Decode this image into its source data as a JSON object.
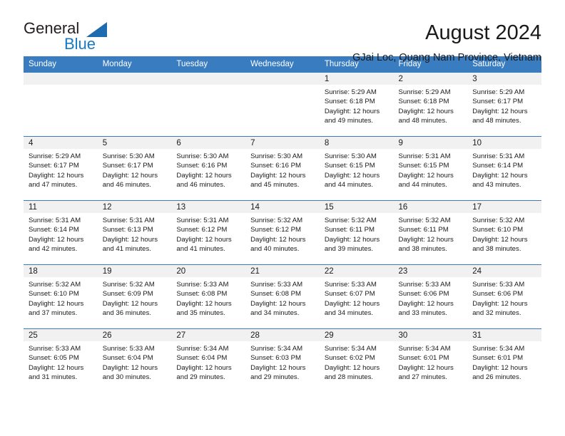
{
  "brand": {
    "name_top": "General",
    "name_bottom": "Blue",
    "triangle_color": "#1f6bb0",
    "blue_text_color": "#1579c4"
  },
  "header": {
    "title": "August 2024",
    "subtitle": "GJai Loc, Quang Nam Province, Vietnam",
    "accent_color": "#3a7cc0",
    "daynum_band_color": "#f1f1f1"
  },
  "weekday_headers": [
    "Sunday",
    "Monday",
    "Tuesday",
    "Wednesday",
    "Thursday",
    "Friday",
    "Saturday"
  ],
  "labels": {
    "sunrise": "Sunrise:",
    "sunset": "Sunset:",
    "daylight": "Daylight:"
  },
  "weeks": [
    [
      {
        "day": "",
        "empty": true
      },
      {
        "day": "",
        "empty": true
      },
      {
        "day": "",
        "empty": true
      },
      {
        "day": "",
        "empty": true
      },
      {
        "day": "1",
        "sunrise": "Sunrise: 5:29 AM",
        "sunset": "Sunset: 6:18 PM",
        "daylight_1": "Daylight: 12 hours",
        "daylight_2": "and 49 minutes."
      },
      {
        "day": "2",
        "sunrise": "Sunrise: 5:29 AM",
        "sunset": "Sunset: 6:18 PM",
        "daylight_1": "Daylight: 12 hours",
        "daylight_2": "and 48 minutes."
      },
      {
        "day": "3",
        "sunrise": "Sunrise: 5:29 AM",
        "sunset": "Sunset: 6:17 PM",
        "daylight_1": "Daylight: 12 hours",
        "daylight_2": "and 48 minutes."
      }
    ],
    [
      {
        "day": "4",
        "sunrise": "Sunrise: 5:29 AM",
        "sunset": "Sunset: 6:17 PM",
        "daylight_1": "Daylight: 12 hours",
        "daylight_2": "and 47 minutes."
      },
      {
        "day": "5",
        "sunrise": "Sunrise: 5:30 AM",
        "sunset": "Sunset: 6:17 PM",
        "daylight_1": "Daylight: 12 hours",
        "daylight_2": "and 46 minutes."
      },
      {
        "day": "6",
        "sunrise": "Sunrise: 5:30 AM",
        "sunset": "Sunset: 6:16 PM",
        "daylight_1": "Daylight: 12 hours",
        "daylight_2": "and 46 minutes."
      },
      {
        "day": "7",
        "sunrise": "Sunrise: 5:30 AM",
        "sunset": "Sunset: 6:16 PM",
        "daylight_1": "Daylight: 12 hours",
        "daylight_2": "and 45 minutes."
      },
      {
        "day": "8",
        "sunrise": "Sunrise: 5:30 AM",
        "sunset": "Sunset: 6:15 PM",
        "daylight_1": "Daylight: 12 hours",
        "daylight_2": "and 44 minutes."
      },
      {
        "day": "9",
        "sunrise": "Sunrise: 5:31 AM",
        "sunset": "Sunset: 6:15 PM",
        "daylight_1": "Daylight: 12 hours",
        "daylight_2": "and 44 minutes."
      },
      {
        "day": "10",
        "sunrise": "Sunrise: 5:31 AM",
        "sunset": "Sunset: 6:14 PM",
        "daylight_1": "Daylight: 12 hours",
        "daylight_2": "and 43 minutes."
      }
    ],
    [
      {
        "day": "11",
        "sunrise": "Sunrise: 5:31 AM",
        "sunset": "Sunset: 6:14 PM",
        "daylight_1": "Daylight: 12 hours",
        "daylight_2": "and 42 minutes."
      },
      {
        "day": "12",
        "sunrise": "Sunrise: 5:31 AM",
        "sunset": "Sunset: 6:13 PM",
        "daylight_1": "Daylight: 12 hours",
        "daylight_2": "and 41 minutes."
      },
      {
        "day": "13",
        "sunrise": "Sunrise: 5:31 AM",
        "sunset": "Sunset: 6:12 PM",
        "daylight_1": "Daylight: 12 hours",
        "daylight_2": "and 41 minutes."
      },
      {
        "day": "14",
        "sunrise": "Sunrise: 5:32 AM",
        "sunset": "Sunset: 6:12 PM",
        "daylight_1": "Daylight: 12 hours",
        "daylight_2": "and 40 minutes."
      },
      {
        "day": "15",
        "sunrise": "Sunrise: 5:32 AM",
        "sunset": "Sunset: 6:11 PM",
        "daylight_1": "Daylight: 12 hours",
        "daylight_2": "and 39 minutes."
      },
      {
        "day": "16",
        "sunrise": "Sunrise: 5:32 AM",
        "sunset": "Sunset: 6:11 PM",
        "daylight_1": "Daylight: 12 hours",
        "daylight_2": "and 38 minutes."
      },
      {
        "day": "17",
        "sunrise": "Sunrise: 5:32 AM",
        "sunset": "Sunset: 6:10 PM",
        "daylight_1": "Daylight: 12 hours",
        "daylight_2": "and 38 minutes."
      }
    ],
    [
      {
        "day": "18",
        "sunrise": "Sunrise: 5:32 AM",
        "sunset": "Sunset: 6:10 PM",
        "daylight_1": "Daylight: 12 hours",
        "daylight_2": "and 37 minutes."
      },
      {
        "day": "19",
        "sunrise": "Sunrise: 5:32 AM",
        "sunset": "Sunset: 6:09 PM",
        "daylight_1": "Daylight: 12 hours",
        "daylight_2": "and 36 minutes."
      },
      {
        "day": "20",
        "sunrise": "Sunrise: 5:33 AM",
        "sunset": "Sunset: 6:08 PM",
        "daylight_1": "Daylight: 12 hours",
        "daylight_2": "and 35 minutes."
      },
      {
        "day": "21",
        "sunrise": "Sunrise: 5:33 AM",
        "sunset": "Sunset: 6:08 PM",
        "daylight_1": "Daylight: 12 hours",
        "daylight_2": "and 34 minutes."
      },
      {
        "day": "22",
        "sunrise": "Sunrise: 5:33 AM",
        "sunset": "Sunset: 6:07 PM",
        "daylight_1": "Daylight: 12 hours",
        "daylight_2": "and 34 minutes."
      },
      {
        "day": "23",
        "sunrise": "Sunrise: 5:33 AM",
        "sunset": "Sunset: 6:06 PM",
        "daylight_1": "Daylight: 12 hours",
        "daylight_2": "and 33 minutes."
      },
      {
        "day": "24",
        "sunrise": "Sunrise: 5:33 AM",
        "sunset": "Sunset: 6:06 PM",
        "daylight_1": "Daylight: 12 hours",
        "daylight_2": "and 32 minutes."
      }
    ],
    [
      {
        "day": "25",
        "sunrise": "Sunrise: 5:33 AM",
        "sunset": "Sunset: 6:05 PM",
        "daylight_1": "Daylight: 12 hours",
        "daylight_2": "and 31 minutes."
      },
      {
        "day": "26",
        "sunrise": "Sunrise: 5:33 AM",
        "sunset": "Sunset: 6:04 PM",
        "daylight_1": "Daylight: 12 hours",
        "daylight_2": "and 30 minutes."
      },
      {
        "day": "27",
        "sunrise": "Sunrise: 5:34 AM",
        "sunset": "Sunset: 6:04 PM",
        "daylight_1": "Daylight: 12 hours",
        "daylight_2": "and 29 minutes."
      },
      {
        "day": "28",
        "sunrise": "Sunrise: 5:34 AM",
        "sunset": "Sunset: 6:03 PM",
        "daylight_1": "Daylight: 12 hours",
        "daylight_2": "and 29 minutes."
      },
      {
        "day": "29",
        "sunrise": "Sunrise: 5:34 AM",
        "sunset": "Sunset: 6:02 PM",
        "daylight_1": "Daylight: 12 hours",
        "daylight_2": "and 28 minutes."
      },
      {
        "day": "30",
        "sunrise": "Sunrise: 5:34 AM",
        "sunset": "Sunset: 6:01 PM",
        "daylight_1": "Daylight: 12 hours",
        "daylight_2": "and 27 minutes."
      },
      {
        "day": "31",
        "sunrise": "Sunrise: 5:34 AM",
        "sunset": "Sunset: 6:01 PM",
        "daylight_1": "Daylight: 12 hours",
        "daylight_2": "and 26 minutes."
      }
    ]
  ]
}
